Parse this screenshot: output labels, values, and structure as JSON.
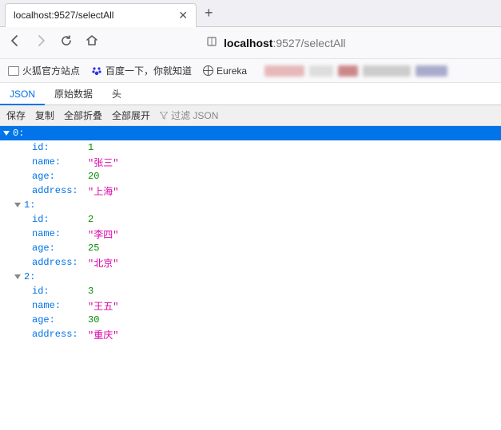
{
  "browser": {
    "tab_title": "localhost:9527/selectAll",
    "close_glyph": "✕",
    "new_tab_glyph": "+"
  },
  "url": {
    "host": "localhost",
    "port": ":9527",
    "path": "/selectAll"
  },
  "bookmarks": {
    "b1": "火狐官方站点",
    "b2": "百度一下，你就知道",
    "b3": "Eureka"
  },
  "view_tabs": {
    "json": "JSON",
    "raw": "原始数据",
    "headers": "头"
  },
  "toolbar": {
    "save": "保存",
    "copy": "复制",
    "collapse_all": "全部折叠",
    "expand_all": "全部展开",
    "filter_placeholder": "过滤 JSON"
  },
  "json_keys": {
    "id": "id",
    "name": "name",
    "age": "age",
    "address": "address"
  },
  "json_data": [
    {
      "idx": "0:",
      "id": "1",
      "name": "\"张三\"",
      "age": "20",
      "address": "\"上海\""
    },
    {
      "idx": "1:",
      "id": "2",
      "name": "\"李四\"",
      "age": "25",
      "address": "\"北京\""
    },
    {
      "idx": "2:",
      "id": "3",
      "name": "\"王五\"",
      "age": "30",
      "address": "\"重庆\""
    }
  ]
}
